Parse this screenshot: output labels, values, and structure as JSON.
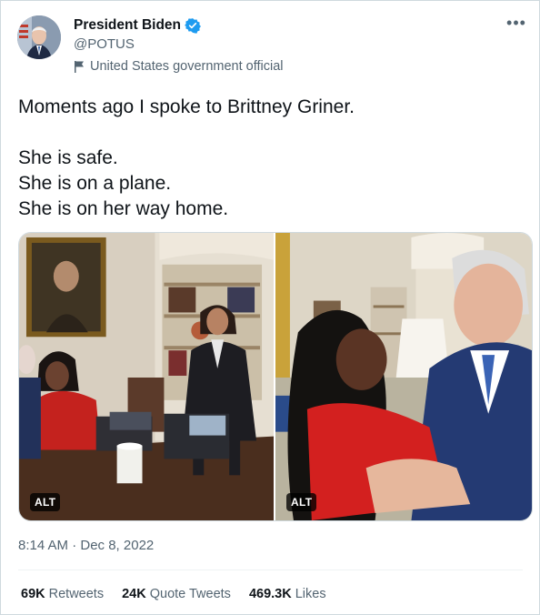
{
  "author": {
    "name": "President Biden",
    "handle": "@POTUS",
    "affiliation": "United States government official",
    "verified": true,
    "verified_color": "#1d9bf0"
  },
  "tweet": {
    "lines": [
      "Moments ago I spoke to Brittney Griner.",
      "She is safe.",
      "She is on a plane.",
      "She is on her way home."
    ]
  },
  "media": [
    {
      "alt_badge": "ALT"
    },
    {
      "alt_badge": "ALT"
    }
  ],
  "timestamp": "8:14 AM · Dec 8, 2022",
  "stats": {
    "retweets_count": "69K",
    "retweets_label": "Retweets",
    "quotes_count": "24K",
    "quotes_label": "Quote Tweets",
    "likes_count": "469.3K",
    "likes_label": "Likes"
  },
  "icons": {
    "more": "more-options-icon",
    "verified": "verified-badge-icon",
    "affiliation": "flag-icon"
  }
}
